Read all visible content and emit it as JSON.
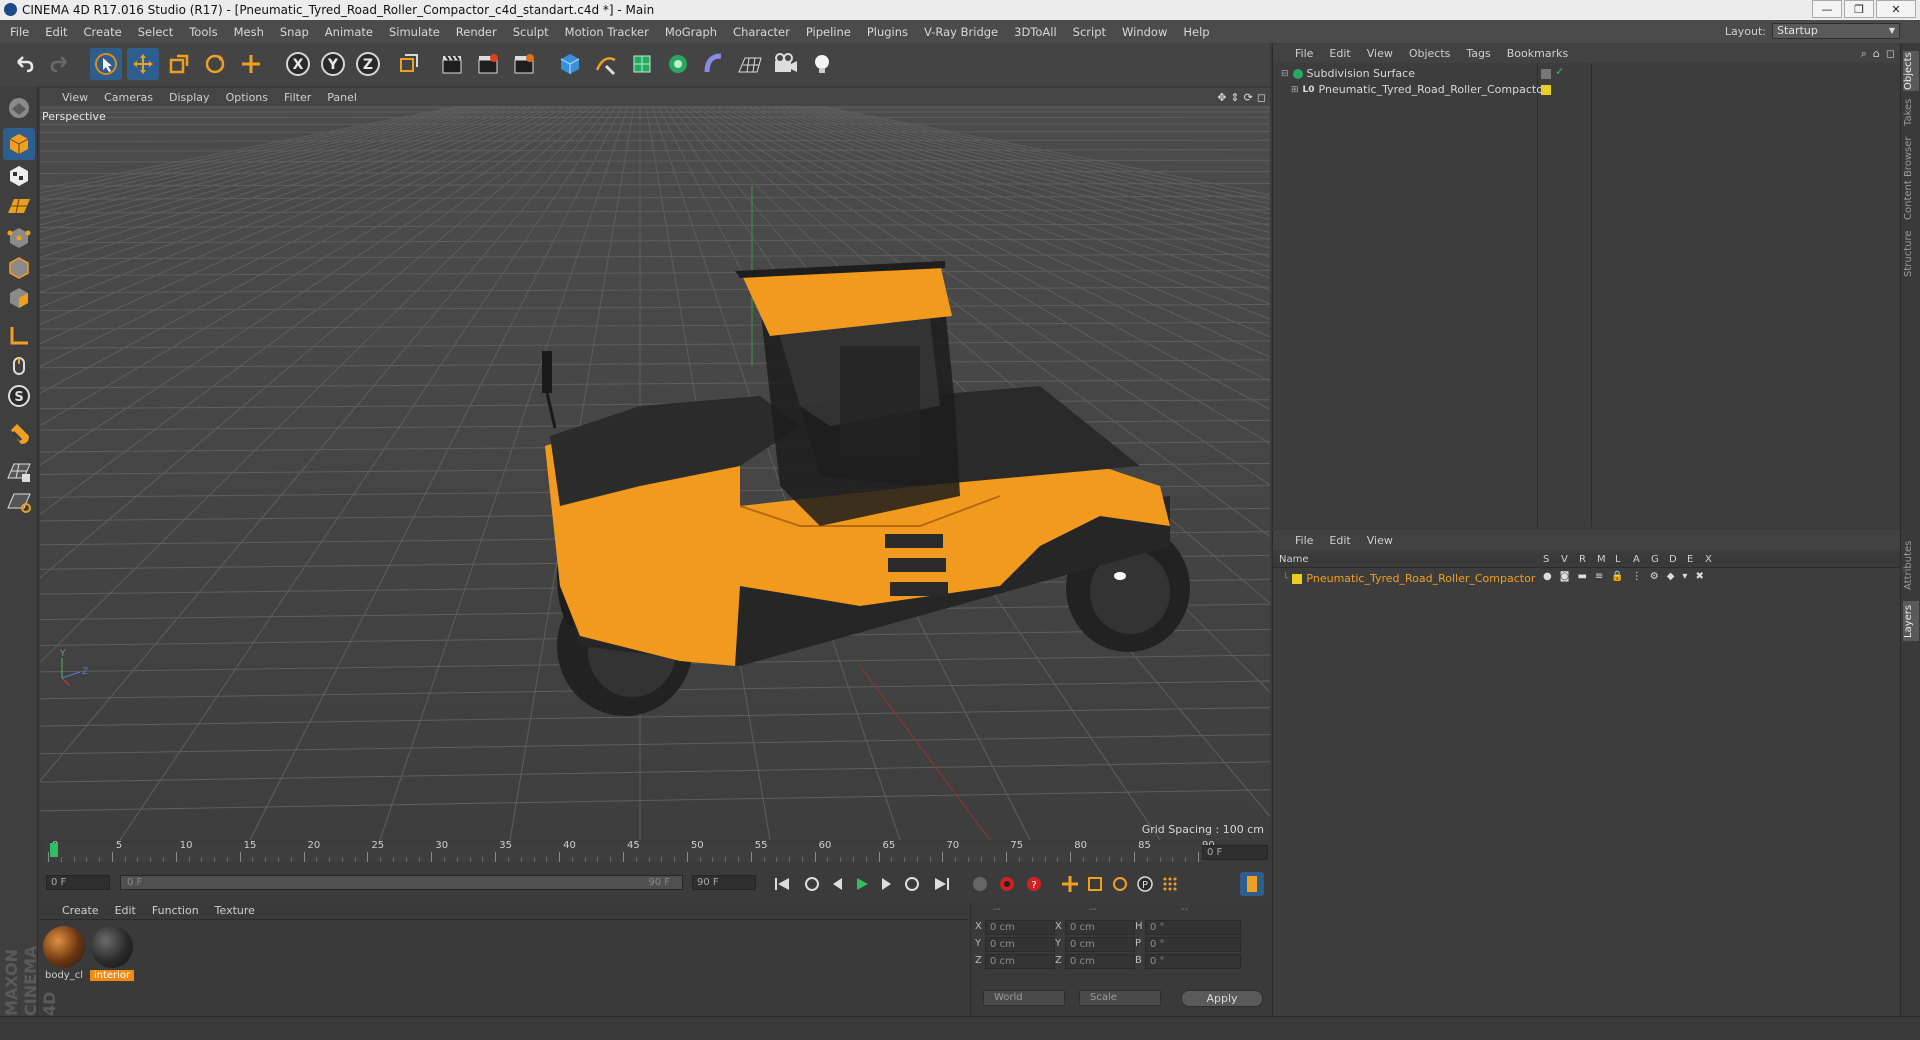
{
  "window": {
    "title": "CINEMA 4D R17.016 Studio (R17) - [Pneumatic_Tyred_Road_Roller_Compactor_c4d_standart.c4d *] - Main",
    "layout_label": "Layout:",
    "layout_value": "Startup"
  },
  "menubar": [
    "File",
    "Edit",
    "Create",
    "Select",
    "Tools",
    "Mesh",
    "Snap",
    "Animate",
    "Simulate",
    "Render",
    "Sculpt",
    "Motion Tracker",
    "MoGraph",
    "Character",
    "Pipeline",
    "Plugins",
    "V-Ray Bridge",
    "3DToAll",
    "Script",
    "Window",
    "Help"
  ],
  "toolbar_icons": [
    "undo-icon",
    "redo-icon",
    "live-selection-icon",
    "move-icon",
    "scale-icon",
    "rotate-icon",
    "move-axis-icon",
    "x-axis-lock-icon",
    "y-axis-lock-icon",
    "z-axis-lock-icon",
    "coordinate-system-icon",
    "render-view-icon",
    "render-to-picture-viewer-icon",
    "edit-render-settings-icon",
    "cube-primitive-icon",
    "pen-spline-icon",
    "subdivision-generator-icon",
    "array-generator-icon",
    "deformer-icon",
    "floor-scene-icon",
    "camera-icon",
    "light-icon"
  ],
  "left_tool_icons": [
    "make-editable-icon",
    "model-mode-icon",
    "texture-mode-icon",
    "workplane-mode-icon",
    "points-mode-icon",
    "edges-mode-icon",
    "polygons-mode-icon",
    "axis-icon",
    "tweak-icon",
    "snap-icon",
    "magnet-icon",
    "grid-lock-icon",
    "workplane-lock-icon"
  ],
  "viewport": {
    "menu": [
      "View",
      "Cameras",
      "Display",
      "Options",
      "Filter",
      "Panel"
    ],
    "label": "Perspective",
    "grid_spacing": "Grid Spacing : 100 cm"
  },
  "timeline": {
    "ticks": [
      "0",
      "5",
      "10",
      "15",
      "20",
      "25",
      "30",
      "35",
      "40",
      "45",
      "50",
      "55",
      "60",
      "65",
      "70",
      "75",
      "80",
      "85",
      "90"
    ],
    "current_frame": "0 F"
  },
  "transport": {
    "start_frame": "0 F",
    "range_start": "0 F",
    "range_end": "90 F",
    "end_frame": "90 F"
  },
  "materials": {
    "menu": [
      "Create",
      "Edit",
      "Function",
      "Texture"
    ],
    "items": [
      {
        "name": "body_cl"
      },
      {
        "name": "interior"
      }
    ]
  },
  "coordinates": {
    "headers": [
      "--",
      "--",
      "--"
    ],
    "rows": [
      {
        "l1": "X",
        "v1": "0 cm",
        "l2": "X",
        "v2": "0 cm",
        "l3": "H",
        "v3": "0 °"
      },
      {
        "l1": "Y",
        "v1": "0 cm",
        "l2": "Y",
        "v2": "0 cm",
        "l3": "P",
        "v3": "0 °"
      },
      {
        "l1": "Z",
        "v1": "0 cm",
        "l2": "Z",
        "v2": "0 cm",
        "l3": "B",
        "v3": "0 °"
      }
    ],
    "space": "World",
    "mode": "Scale",
    "apply": "Apply"
  },
  "objects": {
    "menu": [
      "File",
      "Edit",
      "View",
      "Objects",
      "Tags",
      "Bookmarks"
    ],
    "items": [
      "Subdivision Surface",
      "Pneumatic_Tyred_Road_Roller_Compactor"
    ]
  },
  "layers": {
    "menu": [
      "File",
      "Edit",
      "View"
    ],
    "columns": [
      "Name",
      "S",
      "V",
      "R",
      "M",
      "L",
      "A",
      "G",
      "D",
      "E",
      "X"
    ],
    "items": [
      "Pneumatic_Tyred_Road_Roller_Compactor"
    ]
  },
  "right_tabs": [
    "Objects",
    "Takes",
    "Content Browser",
    "Structure",
    "Attributes",
    "Layers"
  ],
  "brand": "MAXON CINEMA 4D",
  "colors": {
    "accent_orange": "#f39c1f",
    "layer_yellow": "#e8d020",
    "selection_blue": "#2d5e8e",
    "grid_bg": "#4a4a4a"
  }
}
